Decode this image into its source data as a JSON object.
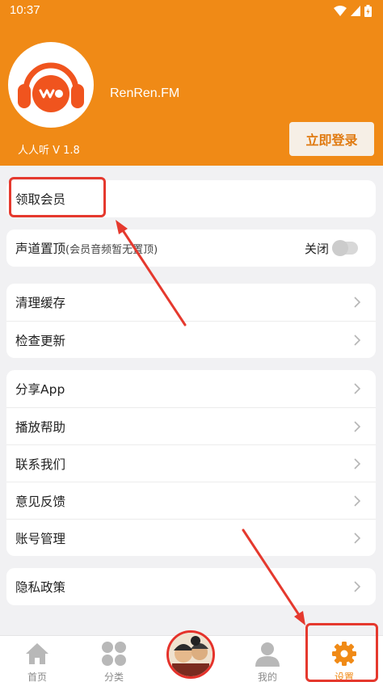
{
  "status_bar": {
    "time": "10:37"
  },
  "header": {
    "app_name": "RenRen.FM",
    "version": "人人听 V 1.8",
    "login_label": "立即登录"
  },
  "member": {
    "label": "领取会员"
  },
  "channel": {
    "label": "声道置顶",
    "sub": "(会员音频暂无置顶)",
    "toggle_label": "关闭",
    "toggle_on": false
  },
  "group1": [
    {
      "label": "清理缓存"
    },
    {
      "label": "检查更新"
    }
  ],
  "group2": [
    {
      "label": "分享App"
    },
    {
      "label": "播放帮助"
    },
    {
      "label": "联系我们"
    },
    {
      "label": "意见反馈"
    },
    {
      "label": "账号管理"
    }
  ],
  "group3": [
    {
      "label": "隐私政策"
    }
  ],
  "tabbar": {
    "home": "首页",
    "category": "分类",
    "mine": "我的",
    "settings": "设置",
    "active": "settings"
  },
  "colors": {
    "accent": "#f08a16",
    "highlight": "#e5392e"
  }
}
